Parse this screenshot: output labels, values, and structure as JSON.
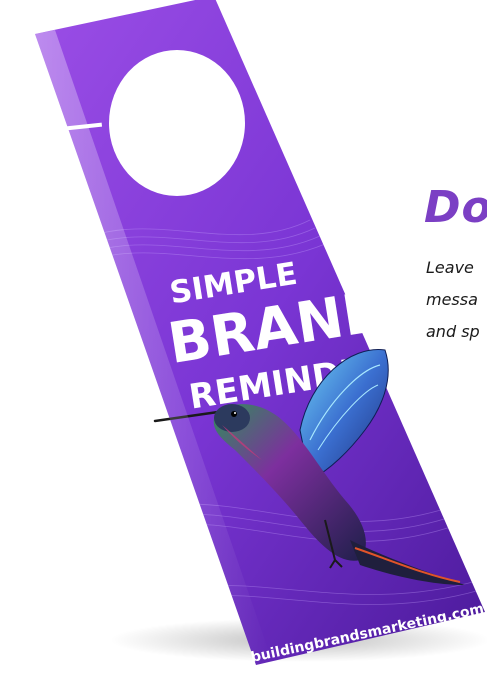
{
  "hanger": {
    "headline_line1": "SIMPLE",
    "headline_line2": "BRAND",
    "headline_line3": "REMINDER",
    "website": "buildingbrandsmarketing.com"
  },
  "side_text": {
    "heading": "Do",
    "line1": "Leave",
    "line2": "messa",
    "line3": "and sp"
  },
  "colors": {
    "hanger_dark": "#4b1a9a",
    "hanger_mid": "#7a35d4",
    "hanger_light": "#9b4ee6",
    "heading": "#7b3fc4",
    "body_text": "#1a1a1a"
  },
  "icons": {
    "bird": "hummingbird-illustration",
    "hole": "door-knob-hole"
  }
}
